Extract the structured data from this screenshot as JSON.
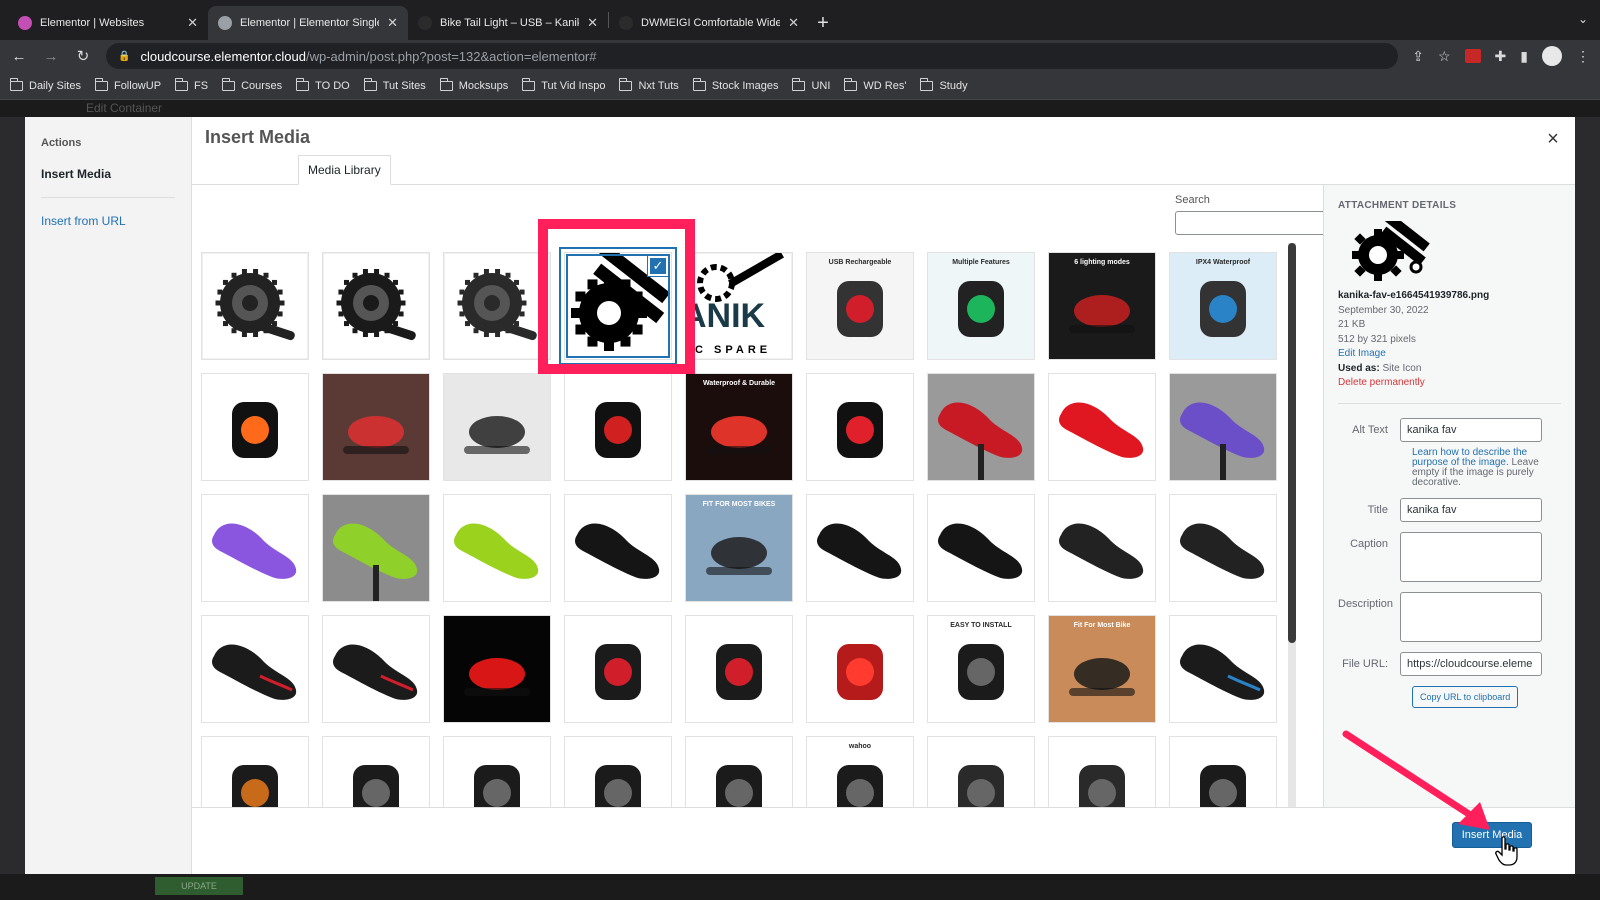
{
  "browser": {
    "tabs": [
      {
        "title": "Elementor | Websites",
        "favicon_color": "#c44fb4",
        "active": false
      },
      {
        "title": "Elementor | Elementor Single P",
        "favicon_color": "#9aa0a6",
        "active": true
      },
      {
        "title": "Bike Tail Light – USB – Kanika F",
        "favicon_color": "#2b2b2b",
        "active": false
      },
      {
        "title": "DWMEIGI Comfortable Wide Bi",
        "favicon_color": "#2b2b2b",
        "active": false
      }
    ],
    "close_glyph": "✕",
    "new_tab_glyph": "+",
    "tab_menu_glyph": "⌄",
    "url_host": "cloudcourse.elementor.cloud",
    "url_path": "/wp-admin/post.php?post=132&action=elementor#",
    "bookmarks": [
      "Daily Sites",
      "FollowUP",
      "FS",
      "Courses",
      "TO DO",
      "Tut Sites",
      "Mocksups",
      "Tut Vid Inspo",
      "Nxt Tuts",
      "Stock Images",
      "UNI",
      "WD Res'",
      "Study"
    ]
  },
  "editor": {
    "panel_title": "Edit Container",
    "update_label": "UPDATE"
  },
  "modal": {
    "sidebar_heading": "Actions",
    "sidebar_current": "Insert Media",
    "sidebar_link": "Insert from URL",
    "title": "Insert Media",
    "close_glyph": "×",
    "tab_label": "Media Library",
    "search_label": "Search",
    "search_value": "",
    "thumbnails": [
      {
        "kind": "crank",
        "bg": "#ffffff",
        "fg": "#222222"
      },
      {
        "kind": "crank",
        "bg": "#ffffff",
        "fg": "#1a1a1a"
      },
      {
        "kind": "crank",
        "bg": "#ffffff",
        "fg": "#2a2a2a"
      },
      {
        "kind": "logo-gear",
        "bg": "#ffffff",
        "fg": "#000000",
        "selected": true
      },
      {
        "kind": "logo-text",
        "bg": "#ffffff",
        "fg": "#000000",
        "text": "ANIK",
        "subtext": "IC SPARE"
      },
      {
        "kind": "product",
        "bg": "#f5f5f5",
        "fg": "#333333",
        "accent": "#d01e2a",
        "badge": "USB Rechargeable"
      },
      {
        "kind": "product",
        "bg": "#eef6f8",
        "fg": "#222222",
        "accent": "#1db55c",
        "badge": "Multiple Features"
      },
      {
        "kind": "photo",
        "bg": "#1a1a1a",
        "fg": "#c82020",
        "badge": "6 lighting modes"
      },
      {
        "kind": "product",
        "bg": "#dcedf8",
        "fg": "#333333",
        "accent": "#2a83c6",
        "badge": "IPX4 Waterproof"
      },
      {
        "kind": "product",
        "bg": "#ffffff",
        "fg": "#111111",
        "accent": "#ff6a1a"
      },
      {
        "kind": "photo",
        "bg": "#5b3a35",
        "fg": "#e03030"
      },
      {
        "kind": "photo",
        "bg": "#e8e8e8",
        "fg": "#222222"
      },
      {
        "kind": "product",
        "bg": "#ffffff",
        "fg": "#111111",
        "accent": "#d02020"
      },
      {
        "kind": "photo",
        "bg": "#1c0d0d",
        "fg": "#ff3b2f",
        "badge": "Waterproof & Durable"
      },
      {
        "kind": "product",
        "bg": "#ffffff",
        "fg": "#111111",
        "accent": "#e0202a"
      },
      {
        "kind": "saddle",
        "bg": "#9a9a9a",
        "fg": "#c71a24"
      },
      {
        "kind": "saddle",
        "bg": "#ffffff",
        "fg": "#e01620"
      },
      {
        "kind": "saddle",
        "bg": "#9a9a9a",
        "fg": "#6a4fc9"
      },
      {
        "kind": "saddle",
        "bg": "#ffffff",
        "fg": "#8a56e0"
      },
      {
        "kind": "saddle",
        "bg": "#8c8c8c",
        "fg": "#8fd12a"
      },
      {
        "kind": "saddle",
        "bg": "#ffffff",
        "fg": "#9ad21e"
      },
      {
        "kind": "saddle",
        "bg": "#ffffff",
        "fg": "#151515"
      },
      {
        "kind": "photo",
        "bg": "#8aa7c2",
        "fg": "#1f1f1f",
        "badge": "FIT FOR MOST BIKES"
      },
      {
        "kind": "saddle",
        "bg": "#ffffff",
        "fg": "#151515"
      },
      {
        "kind": "saddle",
        "bg": "#ffffff",
        "fg": "#151515"
      },
      {
        "kind": "saddle",
        "bg": "#ffffff",
        "fg": "#222222"
      },
      {
        "kind": "saddle",
        "bg": "#ffffff",
        "fg": "#222222"
      },
      {
        "kind": "saddle",
        "bg": "#ffffff",
        "fg": "#1b1b1b",
        "accent": "#d01e2a"
      },
      {
        "kind": "saddle",
        "bg": "#ffffff",
        "fg": "#1b1b1b",
        "accent": "#d01e2a"
      },
      {
        "kind": "photo",
        "bg": "#050505",
        "fg": "#ff1a1a"
      },
      {
        "kind": "product",
        "bg": "#ffffff",
        "fg": "#1b1b1b",
        "accent": "#d01e2a"
      },
      {
        "kind": "product",
        "bg": "#ffffff",
        "fg": "#1b1b1b",
        "accent": "#d01e2a"
      },
      {
        "kind": "product",
        "bg": "#ffffff",
        "fg": "#b51b1b",
        "accent": "#ff3b2f"
      },
      {
        "kind": "product",
        "bg": "#ffffff",
        "fg": "#1b1b1b",
        "badge": "EASY TO INSTALL"
      },
      {
        "kind": "photo",
        "bg": "#c98b5a",
        "fg": "#1b1b1b",
        "badge": "Fit For Most Bike"
      },
      {
        "kind": "saddle",
        "bg": "#ffffff",
        "fg": "#1b1b1b",
        "accent": "#2a83c6"
      },
      {
        "kind": "product",
        "bg": "#ffffff",
        "fg": "#1b1b1b",
        "accent": "#c76a1a"
      },
      {
        "kind": "product",
        "bg": "#ffffff",
        "fg": "#1b1b1b"
      },
      {
        "kind": "product",
        "bg": "#ffffff",
        "fg": "#1b1b1b"
      },
      {
        "kind": "product",
        "bg": "#ffffff",
        "fg": "#1b1b1b"
      },
      {
        "kind": "product",
        "bg": "#ffffff",
        "fg": "#1b1b1b"
      },
      {
        "kind": "product",
        "bg": "#ffffff",
        "fg": "#1b1b1b",
        "badge": "wahoo"
      },
      {
        "kind": "product",
        "bg": "#ffffff",
        "fg": "#2a2a2a"
      },
      {
        "kind": "product",
        "bg": "#ffffff",
        "fg": "#2a2a2a"
      },
      {
        "kind": "product",
        "bg": "#ffffff",
        "fg": "#1b1b1b"
      }
    ],
    "details": {
      "heading": "ATTACHMENT DETAILS",
      "filename": "kanika-fav-e1664541939786.png",
      "date": "September 30, 2022",
      "size": "21 KB",
      "dimensions": "512 by 321 pixels",
      "edit_link": "Edit Image",
      "used_as_label": "Used as:",
      "used_as_value": "Site Icon",
      "delete_link": "Delete permanently",
      "alt_label": "Alt Text",
      "alt_value": "kanika fav",
      "alt_help_link": "Learn how to describe the purpose of the image.",
      "alt_help_text": "Leave empty if the image is purely decorative.",
      "title_label": "Title",
      "title_value": "kanika fav",
      "caption_label": "Caption",
      "caption_value": "",
      "description_label": "Description",
      "description_value": "",
      "url_label": "File URL:",
      "url_value": "https://cloudcourse.eleme",
      "copy_button": "Copy URL to clipboard"
    },
    "insert_button": "Insert Media"
  },
  "colors": {
    "accent": "#2271b1",
    "highlight": "#ff1f5a",
    "danger": "#d63638"
  }
}
